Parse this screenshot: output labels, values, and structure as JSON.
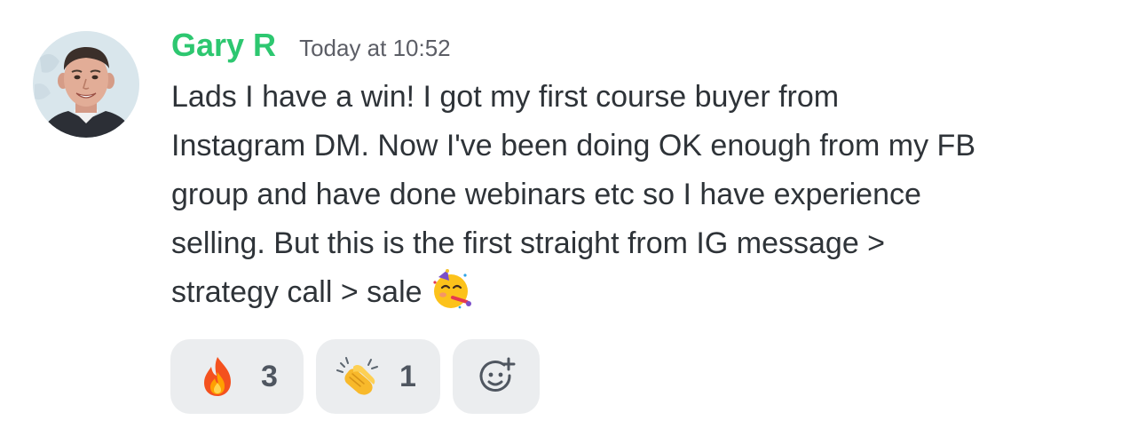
{
  "message": {
    "author": "Gary R",
    "timestamp": "Today at 10:52",
    "author_color": "#2dc770",
    "avatar_icon": "user-avatar-photo",
    "lines": [
      "Lads I have a win! I got my first course buyer from",
      "Instagram DM. Now I've been doing OK enough from my FB",
      "group and have done webinars etc so I have experience",
      "selling. But this is the first straight from IG message >",
      "strategy call > sale"
    ],
    "inline_emoji": "partying-face-emoji"
  },
  "reactions": [
    {
      "emoji": "fire-emoji",
      "count": "3"
    },
    {
      "emoji": "clapping-hands-emoji",
      "count": "1"
    }
  ],
  "add_reaction": {
    "icon": "add-reaction-smiley-icon"
  }
}
